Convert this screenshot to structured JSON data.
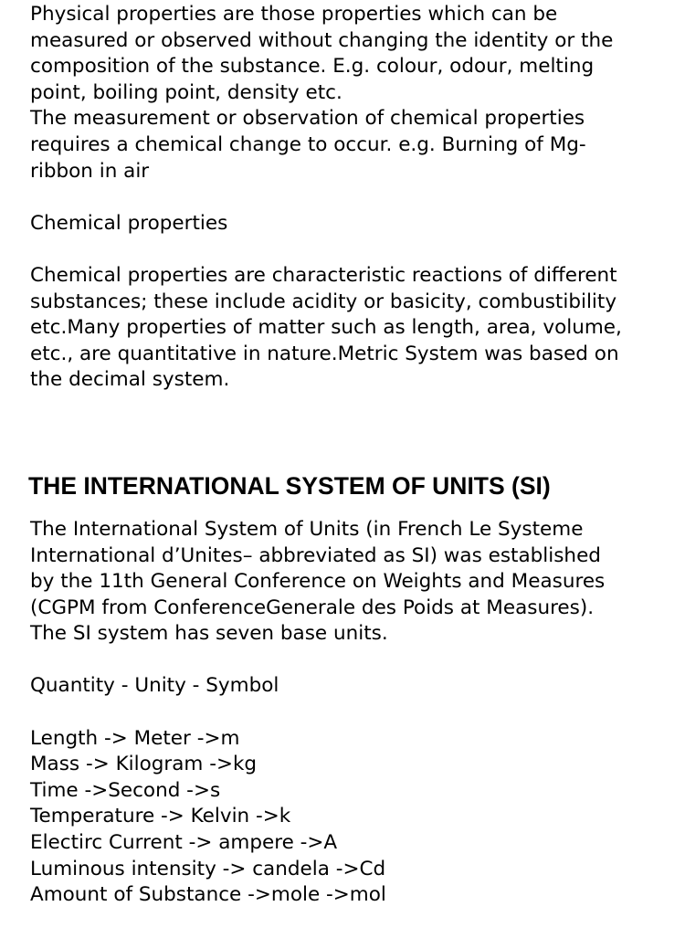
{
  "intro_paragraph": {
    "lines": [
      "Physical properties are those properties which can be",
      "measured or observed without changing the identity or the",
      "composition of the substance. E.g. colour, odour, melting",
      "point, boiling point, density etc.",
      "The measurement or observation of chemical properties",
      "requires a chemical change to occur. e.g. Burning of Mg-",
      "ribbon in air"
    ]
  },
  "chemical_properties_label": "Chemical properties",
  "chemical_paragraph": {
    "lines": [
      "Chemical properties are characteristic reactions of different",
      "substances; these include acidity or basicity, combustibility",
      "etc.Many properties of matter such as length, area, volume,",
      "etc., are quantitative in nature.Metric System was based on",
      "the decimal system."
    ]
  },
  "si_heading": "THE INTERNATIONAL SYSTEM OF UNITS (SI)",
  "si_paragraph": {
    "lines": [
      "The International System of Units (in French Le Systeme",
      "International d’Unites– abbreviated as SI) was established",
      "by the 11th General Conference on Weights and Measures",
      "(CGPM from ConferenceGenerale des Poids at Measures).",
      "The SI system has seven base units."
    ]
  },
  "units_header": "Quantity - Unity - Symbol",
  "units_list": [
    "Length -> Meter ->m",
    "Mass -> Kilogram ->kg",
    "Time ->Second ->s",
    "Temperature -> Kelvin ->k",
    "Electirc Current -> ampere ->A",
    "Luminous intensity -> candela ->Cd",
    "Amount of Substance ->mole ->mol"
  ]
}
